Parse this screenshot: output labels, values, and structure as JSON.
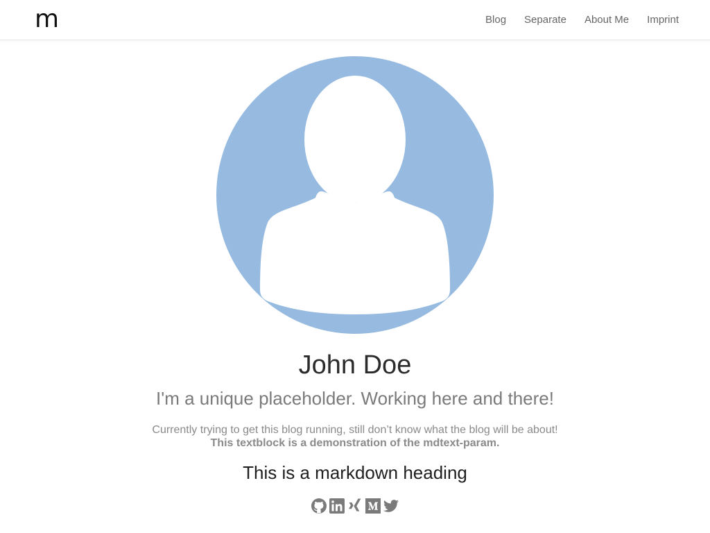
{
  "brand": {
    "logo_text": "m"
  },
  "nav": {
    "items": [
      {
        "label": "Blog"
      },
      {
        "label": "Separate"
      },
      {
        "label": "About Me"
      },
      {
        "label": "Imprint"
      }
    ]
  },
  "profile": {
    "avatar_icon": "person-placeholder-icon",
    "name": "John Doe",
    "tagline": "I'm a unique placeholder. Working here and there!",
    "description_line1": "Currently trying to get this blog running, still don’t know what the blog will be about!",
    "description_line2": "This textblock is a demonstration of the mdtext-param.",
    "markdown_heading": "This is a markdown heading"
  },
  "socials": [
    {
      "icon": "github-icon"
    },
    {
      "icon": "linkedin-icon"
    },
    {
      "icon": "xing-icon"
    },
    {
      "icon": "medium-icon"
    },
    {
      "icon": "twitter-icon"
    }
  ],
  "colors": {
    "avatar_bg": "#97bbe0",
    "icon_gray": "#7a7a7a",
    "text_dark": "#2b2b2b",
    "text_muted": "#7a7a7a"
  }
}
